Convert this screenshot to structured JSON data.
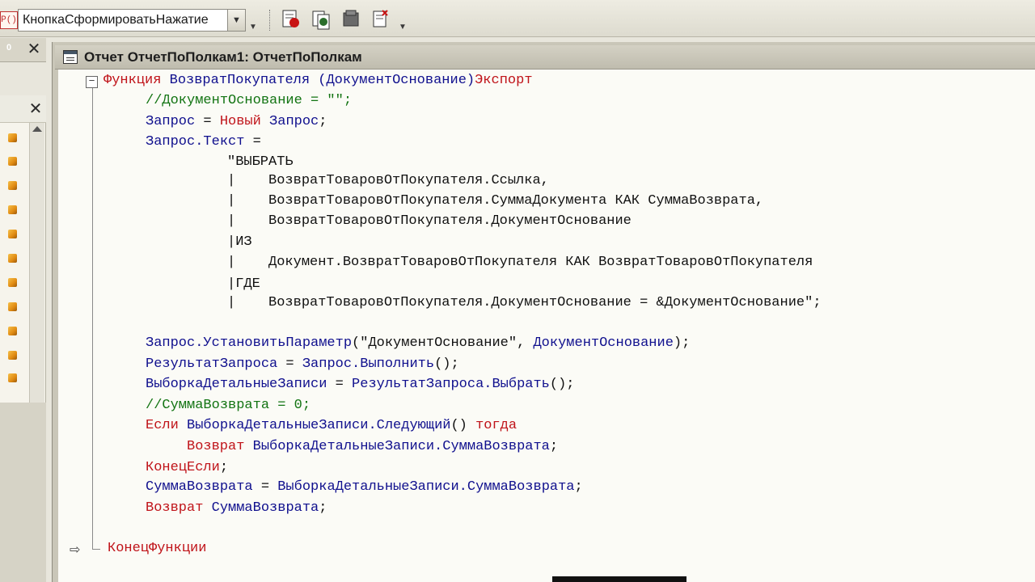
{
  "toolbar": {
    "proc_icon_text": "P()",
    "procedure_selector_value": "КнопкаСформироватьНажатие",
    "buttons": [
      "add-breakpoint",
      "toggle-breakpoint",
      "module-list",
      "edit-syntax"
    ]
  },
  "left_panel": {
    "pin_label": "0",
    "close_label": "✕"
  },
  "window": {
    "title": "Отчет ОтчетПоПолкам1: ОтчетПоПолкам"
  },
  "code": {
    "lines": [
      [
        [
          "kw",
          "Функция "
        ],
        [
          "id",
          "ВозвратПокупателя"
        ],
        [
          "st",
          " "
        ],
        [
          "id",
          "(ДокументОснование)"
        ],
        [
          "kw",
          "Экспорт"
        ]
      ],
      [
        [
          "cm",
          "//ДокументОснование = \"\";"
        ]
      ],
      [
        [
          "id",
          "Запрос"
        ],
        [
          "st",
          " = "
        ],
        [
          "kw",
          "Новый"
        ],
        [
          "st",
          " "
        ],
        [
          "id",
          "Запрос"
        ],
        [
          "st",
          ";"
        ]
      ],
      [
        [
          "id",
          "Запрос.Текст"
        ],
        [
          "st",
          " ="
        ]
      ],
      [
        [
          "st",
          "\"ВЫБРАТЬ"
        ]
      ],
      [
        [
          "st",
          "|    ВозвратТоваровОтПокупателя.Ссылка,"
        ]
      ],
      [
        [
          "st",
          "|    ВозвратТоваровОтПокупателя.СуммаДокумента КАК СуммаВозврата,"
        ]
      ],
      [
        [
          "st",
          "|    ВозвратТоваровОтПокупателя.ДокументОснование"
        ]
      ],
      [
        [
          "st",
          "|ИЗ"
        ]
      ],
      [
        [
          "st",
          "|    Документ.ВозвратТоваровОтПокупателя КАК ВозвратТоваровОтПокупателя"
        ]
      ],
      [
        [
          "st",
          "|ГДЕ"
        ]
      ],
      [
        [
          "st",
          "|    ВозвратТоваровОтПокупателя.ДокументОснование = &ДокументОснование\";"
        ]
      ],
      [
        [
          "id",
          "Запрос.УстановитьПараметр"
        ],
        [
          "st",
          "(\"ДокументОснование\", "
        ],
        [
          "id",
          "ДокументОснование"
        ],
        [
          "st",
          ");"
        ]
      ],
      [
        [
          "id",
          "РезультатЗапроса"
        ],
        [
          "st",
          " = "
        ],
        [
          "id",
          "Запрос.Выполнить"
        ],
        [
          "st",
          "();"
        ]
      ],
      [
        [
          "id",
          "ВыборкаДетальныеЗаписи"
        ],
        [
          "st",
          " = "
        ],
        [
          "id",
          "РезультатЗапроса.Выбрать"
        ],
        [
          "st",
          "();"
        ]
      ],
      [
        [
          "cm",
          "//СуммаВозврата = 0;"
        ]
      ],
      [
        [
          "kw",
          "Если "
        ],
        [
          "id",
          "ВыборкаДетальныеЗаписи.Следующий"
        ],
        [
          "st",
          "() "
        ],
        [
          "kw",
          "тогда"
        ]
      ],
      [
        [
          "kw",
          "Возврат "
        ],
        [
          "id",
          "ВыборкаДетальныеЗаписи.СуммаВозврата"
        ],
        [
          "st",
          ";"
        ]
      ],
      [
        [
          "kw",
          "КонецЕсли"
        ],
        [
          "st",
          ";"
        ]
      ],
      [
        [
          "id",
          "СуммаВозврата"
        ],
        [
          "st",
          " = "
        ],
        [
          "id",
          "ВыборкаДетальныеЗаписи.СуммаВозврата"
        ],
        [
          "st",
          ";"
        ]
      ],
      [
        [
          "kw",
          "Возврат "
        ],
        [
          "id",
          "СуммаВозврата"
        ],
        [
          "st",
          ";"
        ]
      ],
      [
        [
          "kw",
          "КонецФункции"
        ]
      ]
    ]
  },
  "colors": {
    "keyword": "#c0141a",
    "identifier": "#10108e",
    "text": "#111111",
    "comment": "#137413",
    "editor_background": "#fbfbf6"
  }
}
